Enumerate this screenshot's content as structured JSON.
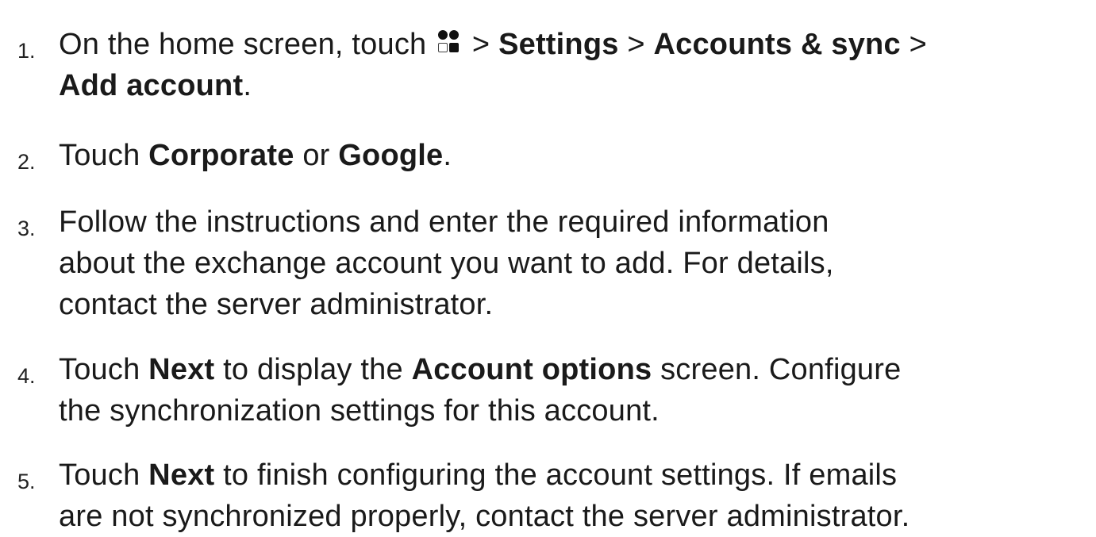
{
  "steps": [
    {
      "number": "1.",
      "line1": {
        "t1": "On the home screen, touch",
        "t2": "> ",
        "b1": "Settings",
        "t3": " > ",
        "b2": "Accounts & sync",
        "t4": " >"
      },
      "line2": {
        "b1": "Add account",
        "t1": "."
      },
      "icon": "app-drawer-icon"
    },
    {
      "number": "2.",
      "line1": {
        "t1": "Touch ",
        "b1": "Corporate",
        "t2": " or ",
        "b2": "Google",
        "t3": "."
      }
    },
    {
      "number": "3.",
      "lines": [
        "Follow the instructions and enter the required information",
        "about the exchange account you want to add. For details,",
        "contact the server administrator."
      ]
    },
    {
      "number": "4.",
      "line1": {
        "t1": "Touch ",
        "b1": "Next",
        "t2": " to display the ",
        "b2": "Account options",
        "t3": " screen. Configure"
      },
      "line2": "the synchronization settings for this account."
    },
    {
      "number": "5.",
      "line1": {
        "t1": "Touch ",
        "b1": "Next",
        "t2": " to finish configuring the account settings. If emails"
      },
      "line2": "are not synchronized properly, contact the server administrator."
    }
  ]
}
